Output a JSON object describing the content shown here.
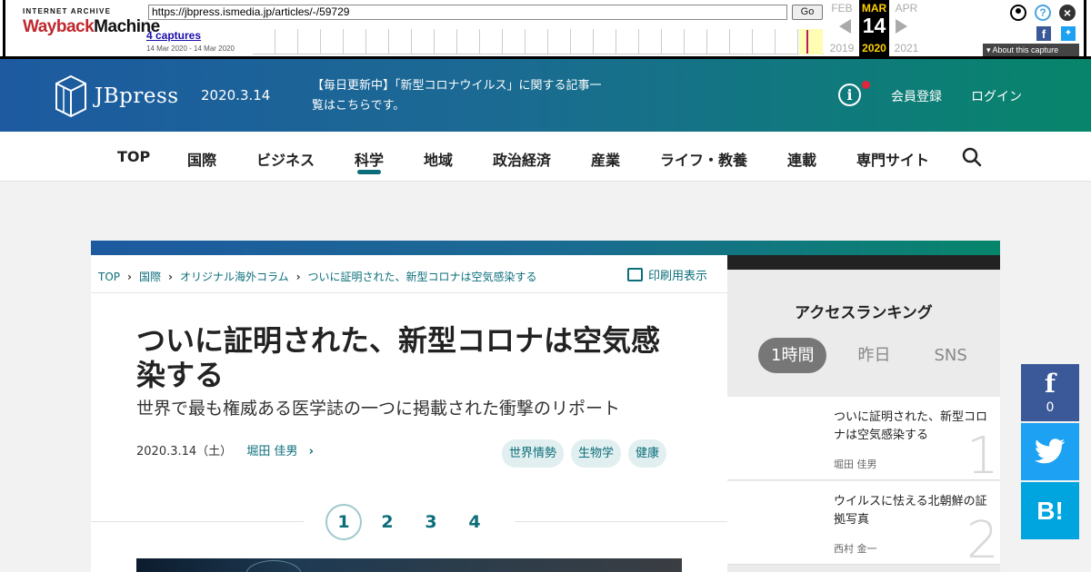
{
  "wayback": {
    "logo_top": "INTERNET ARCHIVE",
    "logo_way": "Wayback",
    "logo_machine": "Machine",
    "url": "https://jbpress.ismedia.jp/articles/-/59729",
    "go_label": "Go",
    "captures": "4 captures",
    "range": "14 Mar 2020 - 14 Mar 2020",
    "prev_month": "FEB",
    "prev_year": "2019",
    "cur_month": "MAR",
    "cur_day": "14",
    "cur_year": "2020",
    "next_month": "APR",
    "next_year": "2021",
    "about": "About this capture",
    "colors": {
      "accent_year": "#ffd000",
      "capture_mark": "#c2185b"
    }
  },
  "header": {
    "logo_text": "JBpress",
    "date": "2020.3.14",
    "news_line1": "【毎日更新中】「新型コロナウイルス」に関する記事一",
    "news_line2": "覧はこちらです。",
    "register": "会員登録",
    "login": "ログイン",
    "colors": {
      "gradient_start": "#1d5aa0",
      "gradient_end": "#07856b",
      "notification_dot": "#e0263a"
    }
  },
  "nav": {
    "items": [
      "TOP",
      "国際",
      "ビジネス",
      "科学",
      "地域",
      "政治経済",
      "産業",
      "ライフ・教養",
      "連載",
      "専門サイト"
    ],
    "active": "科学"
  },
  "article": {
    "breadcrumbs": [
      "TOP",
      "国際",
      "オリジナル海外コラム",
      "ついに証明された、新型コロナは空気感染する"
    ],
    "print_label": "印刷用表示",
    "title": "ついに証明された、新型コロナは空気感染する",
    "subtitle": "世界で最も権威ある医学誌の一つに掲載された衝撃のリポート",
    "date": "2020.3.14（土）",
    "author": "堀田 佳男",
    "tags": [
      "世界情勢",
      "生物学",
      "健康"
    ],
    "pages": [
      "1",
      "2",
      "3",
      "4"
    ],
    "current_page": "1"
  },
  "sidebar": {
    "title": "アクセスランキング",
    "tabs": [
      "1時間",
      "昨日",
      "SNS"
    ],
    "ranking": [
      {
        "title": "ついに証明された、新型コロナは空気感染する",
        "author": "堀田 佳男",
        "rank": "1"
      },
      {
        "title": "ウイルスに怯える北朝鮮の証拠写真",
        "author": "西村 金一",
        "rank": "2"
      }
    ]
  },
  "share": {
    "facebook_count": "0",
    "hatena_label": "B!"
  }
}
